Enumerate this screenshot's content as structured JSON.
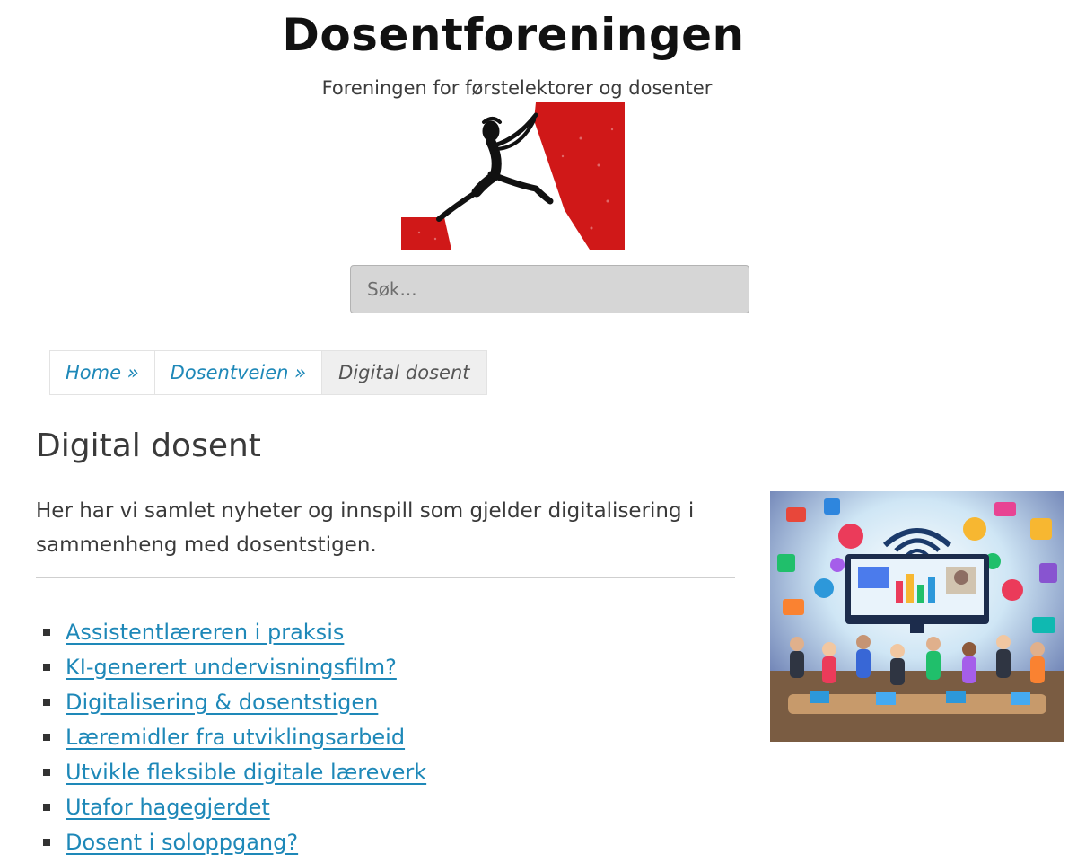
{
  "site": {
    "title": "Dosentforeningen",
    "tagline": "Foreningen for førstelektorer og dosenter"
  },
  "search": {
    "placeholder": "Søk..."
  },
  "breadcrumb": {
    "home": "Home »",
    "dosentveien": "Dosentveien »",
    "current": "Digital dosent"
  },
  "page": {
    "title": "Digital dosent",
    "intro": "Her har vi samlet nyheter og innspill som gjelder digitalisering i sammenheng med dosentstigen."
  },
  "posts": [
    "Assistentlæreren i praksis",
    "KI-generert undervisningsfilm?",
    "Digitalisering & dosentstigen",
    "Læremidler fra utviklingsarbeid",
    "Utvikle fleksible digitale læreverk",
    "Utafor hagegjerdet",
    "Dosent i soloppgang?"
  ],
  "colors": {
    "link": "#1e88b8",
    "logo_red": "#d01818",
    "text": "#3a3a3a"
  }
}
